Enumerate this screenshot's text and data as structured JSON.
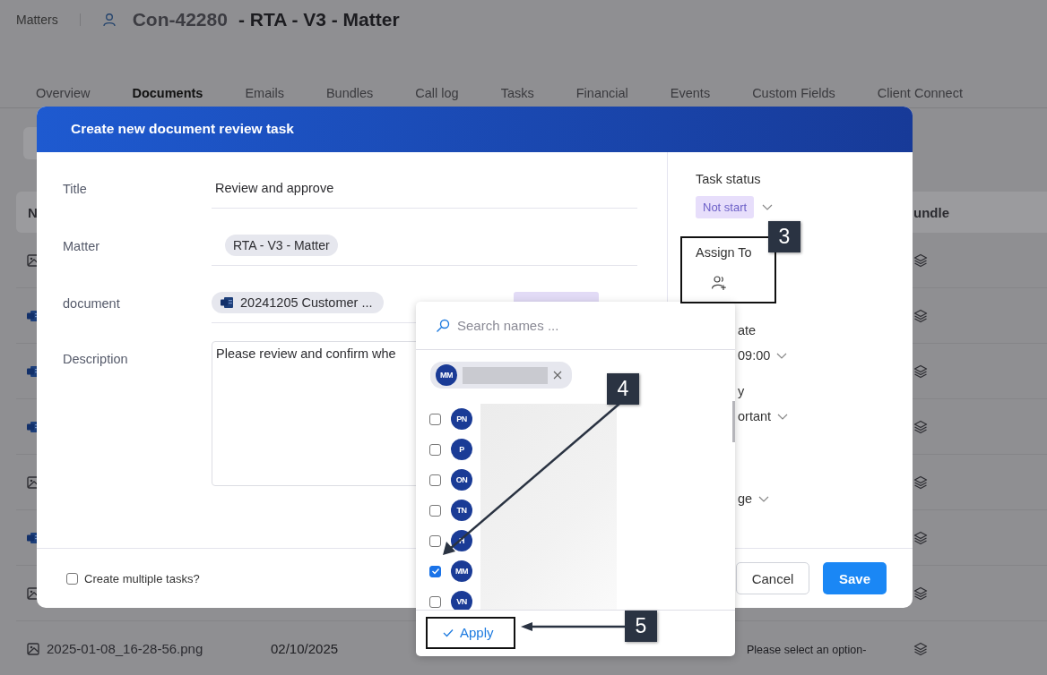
{
  "breadcrumb": "Matters",
  "matter": {
    "code": "Con-42280",
    "title": "- RTA - V3 - Matter"
  },
  "tabs": [
    {
      "label": "Overview",
      "selected": false
    },
    {
      "label": "Documents",
      "selected": true
    },
    {
      "label": "Emails",
      "selected": false
    },
    {
      "label": "Bundles",
      "selected": false
    },
    {
      "label": "Call log",
      "selected": false
    },
    {
      "label": "Tasks",
      "selected": false
    },
    {
      "label": "Financial",
      "selected": false
    },
    {
      "label": "Events",
      "selected": false
    },
    {
      "label": "Custom Fields",
      "selected": false
    },
    {
      "label": "Client Connect",
      "selected": false
    }
  ],
  "table": {
    "columns": [
      "N",
      "undle"
    ],
    "rows": [
      {
        "kind": "image"
      },
      {
        "kind": "word"
      },
      {
        "kind": "word"
      },
      {
        "kind": "word"
      },
      {
        "kind": "image"
      },
      {
        "kind": "word"
      },
      {
        "kind": "image"
      },
      {
        "kind": "image",
        "name": "2025-01-08_16-28-56.png",
        "date": "02/10/2025",
        "option": "Please select an option-"
      }
    ]
  },
  "modal": {
    "title": "Create new document review task",
    "fields": [
      {
        "kind": "text",
        "label": "Title",
        "value": "Review and approve"
      },
      {
        "kind": "chip",
        "label": "Matter",
        "value": "RTA - V3 - Matter"
      },
      {
        "kind": "document",
        "label": "document",
        "value": "20241205 Customer ...",
        "status_tag": true
      },
      {
        "kind": "textarea",
        "label": "Description",
        "value": "Please review and confirm whe"
      }
    ],
    "task_status": {
      "label": "Task status",
      "value": "Not start"
    },
    "assign": {
      "label": "Assign To"
    },
    "partial_fields": [
      {
        "label": "ate",
        "value": "09:00"
      },
      {
        "label": "y",
        "value": "ortant"
      },
      {
        "value": "ge"
      }
    ],
    "multiple": {
      "label": "Create multiple tasks?",
      "checked": false
    },
    "buttons": [
      {
        "kind": "secondary",
        "label": "Cancel"
      },
      {
        "kind": "primary",
        "label": "Save"
      }
    ]
  },
  "picker": {
    "placeholder": "Search names ...",
    "chips": [
      {
        "initials": "MM"
      }
    ],
    "options": [
      {
        "initials": "PN",
        "checked": false
      },
      {
        "initials": "P",
        "checked": false
      },
      {
        "initials": "ON",
        "checked": false
      },
      {
        "initials": "TN",
        "checked": false
      },
      {
        "initials": "H",
        "checked": false
      },
      {
        "initials": "MM",
        "checked": true
      },
      {
        "initials": "VN",
        "checked": false
      }
    ],
    "apply": "Apply"
  },
  "callouts": [
    {
      "number": "3"
    },
    {
      "number": "4"
    },
    {
      "number": "5"
    }
  ]
}
